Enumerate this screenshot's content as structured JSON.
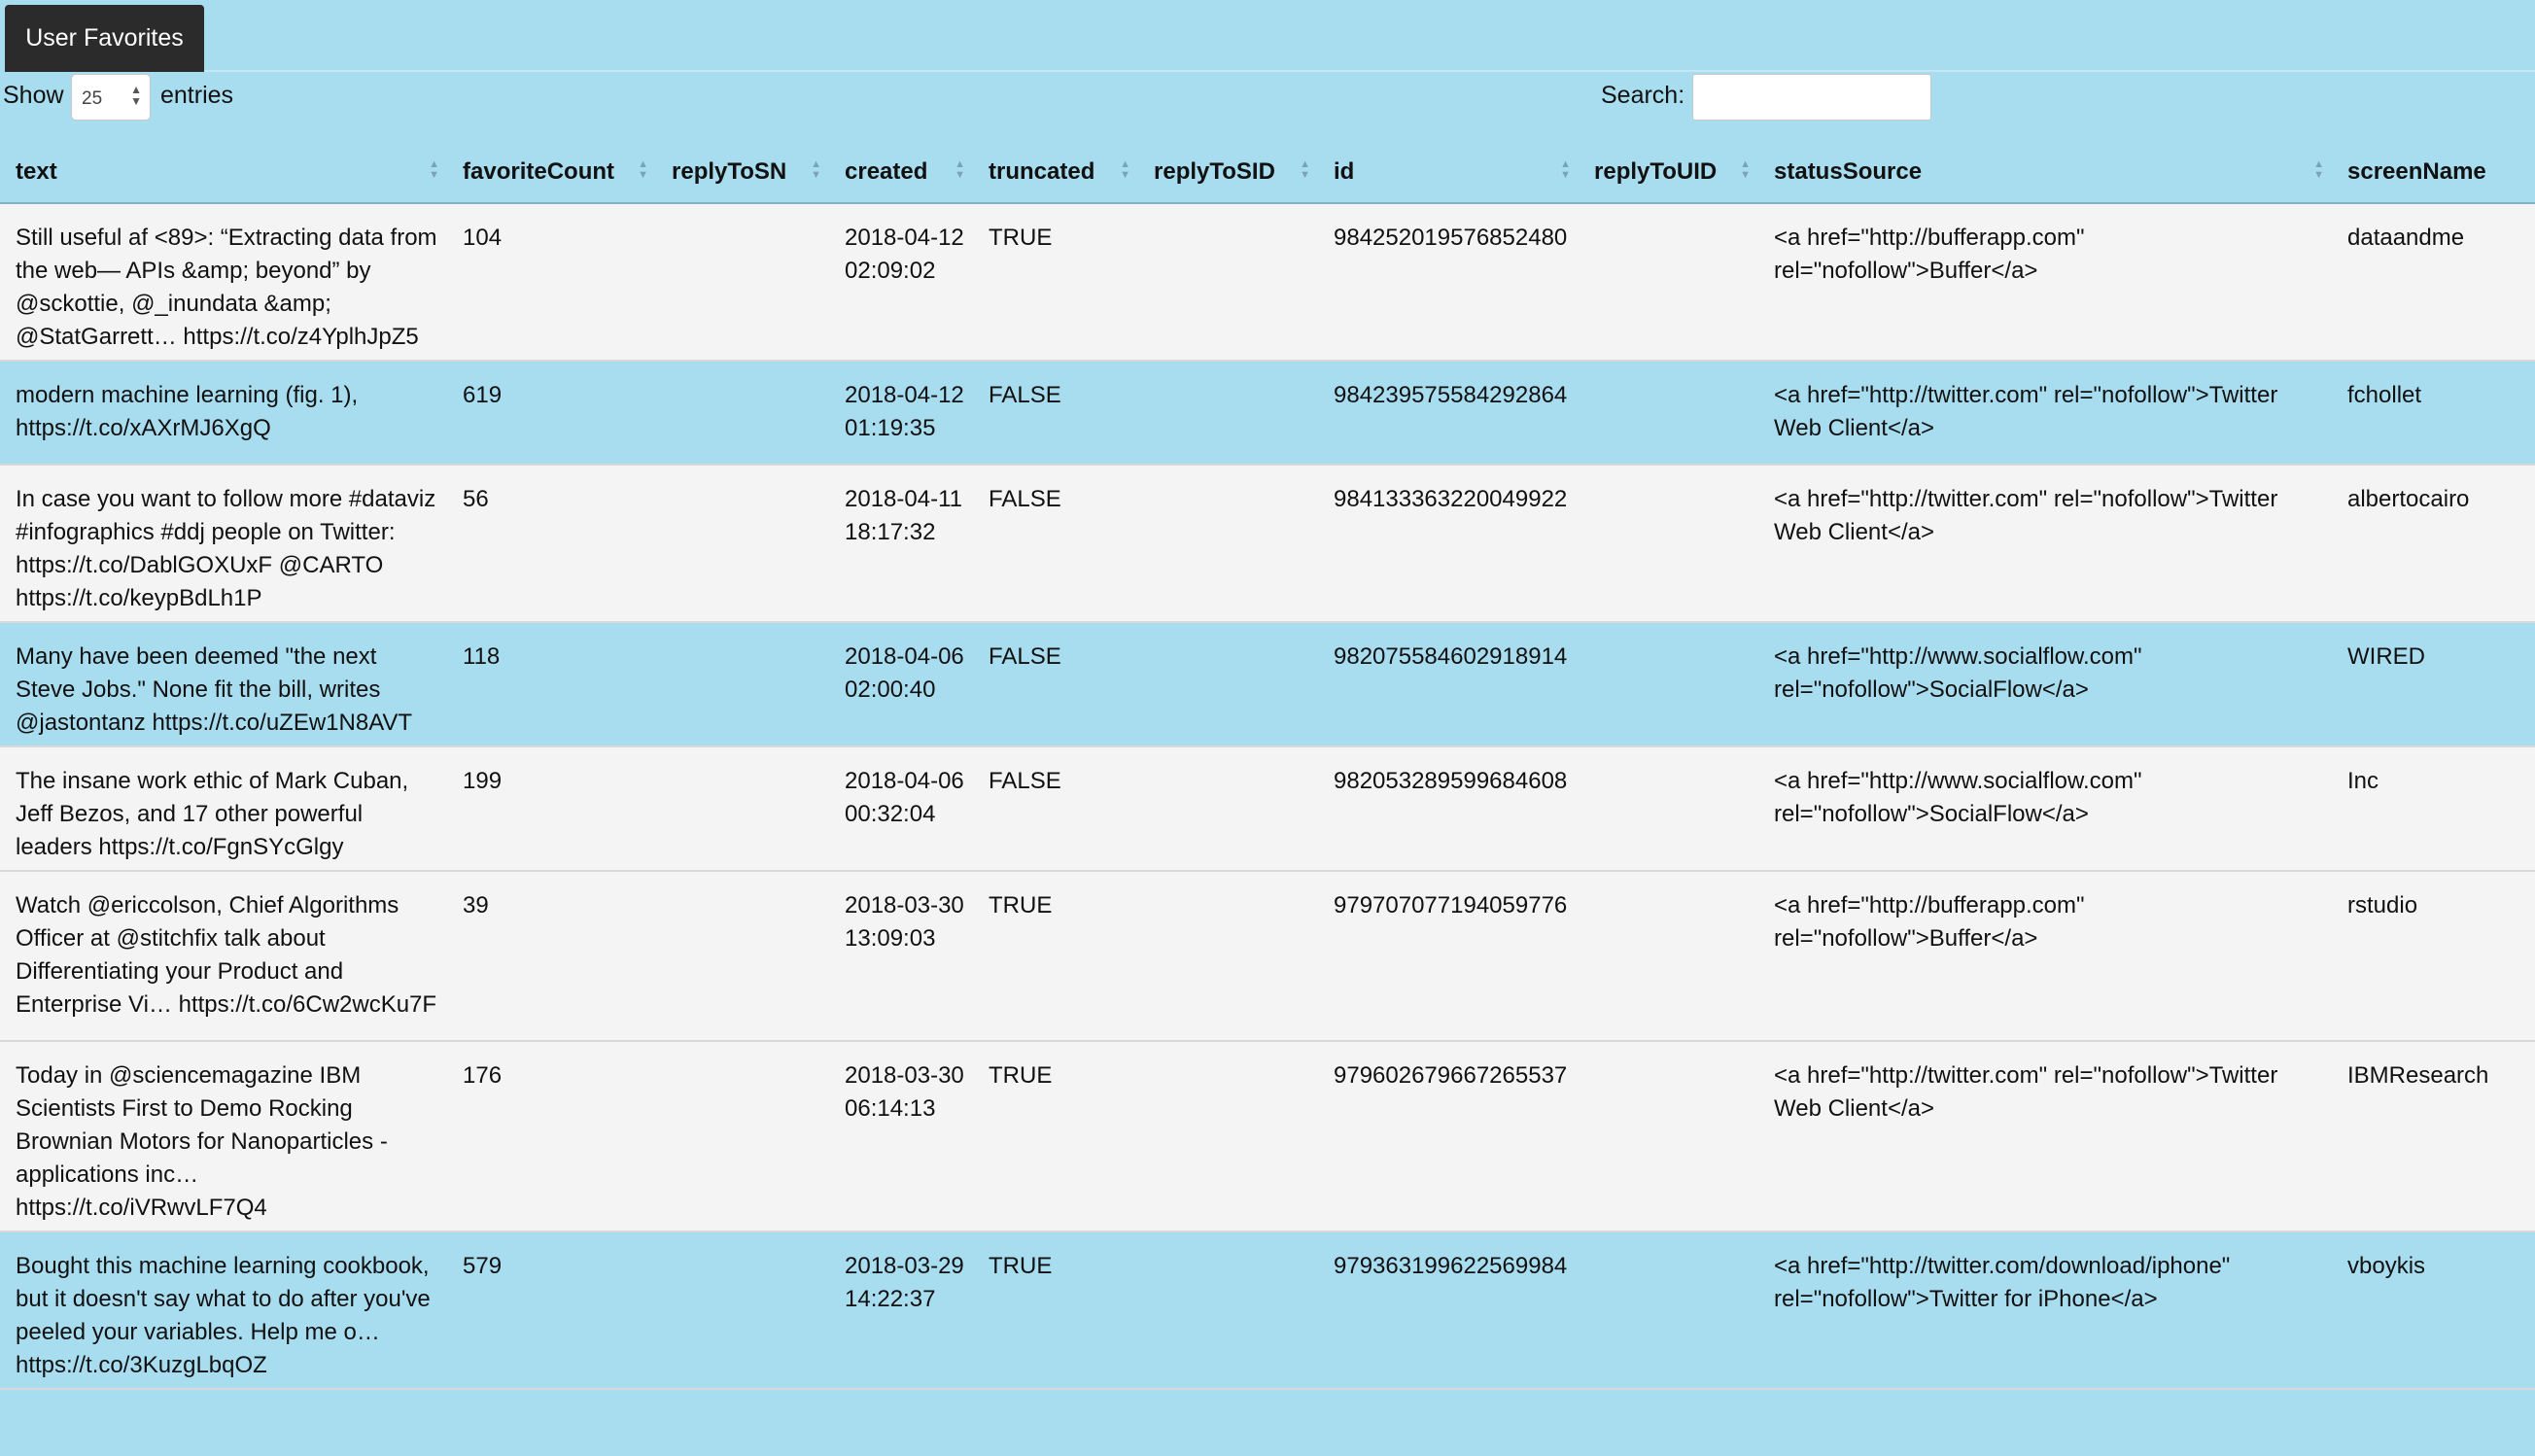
{
  "tab": {
    "label": "User Favorites"
  },
  "controls": {
    "show_label": "Show",
    "page_size": "25",
    "entries_label": "entries",
    "search_label": "Search:",
    "search_value": ""
  },
  "table": {
    "columns": [
      "text",
      "favoriteCount",
      "replyToSN",
      "created",
      "truncated",
      "replyToSID",
      "id",
      "replyToUID",
      "statusSource",
      "screenName"
    ],
    "rows": [
      {
        "text": "Still useful af <89>: “Extracting data from the web— APIs &amp; beyond” by @sckottie, @_inundata &amp; @StatGarrett… https://t.co/z4YplhJpZ5",
        "favoriteCount": "104",
        "replyToSN": "",
        "created": "2018-04-12 02:09:02",
        "truncated": "TRUE",
        "replyToSID": "",
        "id": "984252019576852480",
        "replyToUID": "",
        "statusSource": "<a href=\"http://bufferapp.com\" rel=\"nofollow\">Buffer</a>",
        "screenName": "dataandme"
      },
      {
        "text": "modern machine learning (fig. 1), https://t.co/xAXrMJ6XgQ",
        "favoriteCount": "619",
        "replyToSN": "",
        "created": "2018-04-12 01:19:35",
        "truncated": "FALSE",
        "replyToSID": "",
        "id": "984239575584292864",
        "replyToUID": "",
        "statusSource": "<a href=\"http://twitter.com\" rel=\"nofollow\">Twitter Web Client</a>",
        "screenName": "fchollet"
      },
      {
        "text": "In case you want to follow more #dataviz #infographics #ddj people on Twitter: https://t.co/DablGOXUxF @CARTO https://t.co/keypBdLh1P",
        "favoriteCount": "56",
        "replyToSN": "",
        "created": "2018-04-11 18:17:32",
        "truncated": "FALSE",
        "replyToSID": "",
        "id": "984133363220049922",
        "replyToUID": "",
        "statusSource": "<a href=\"http://twitter.com\" rel=\"nofollow\">Twitter Web Client</a>",
        "screenName": "albertocairo"
      },
      {
        "text": "Many have been deemed \"the next Steve Jobs.\" None fit the bill, writes @jastontanz https://t.co/uZEw1N8AVT",
        "favoriteCount": "118",
        "replyToSN": "",
        "created": "2018-04-06 02:00:40",
        "truncated": "FALSE",
        "replyToSID": "",
        "id": "982075584602918914",
        "replyToUID": "",
        "statusSource": "<a href=\"http://www.socialflow.com\" rel=\"nofollow\">SocialFlow</a>",
        "screenName": "WIRED"
      },
      {
        "text": "The insane work ethic of Mark Cuban, Jeff Bezos, and 17 other powerful leaders https://t.co/FgnSYcGlgy",
        "favoriteCount": "199",
        "replyToSN": "",
        "created": "2018-04-06 00:32:04",
        "truncated": "FALSE",
        "replyToSID": "",
        "id": "982053289599684608",
        "replyToUID": "",
        "statusSource": "<a href=\"http://www.socialflow.com\" rel=\"nofollow\">SocialFlow</a>",
        "screenName": "Inc"
      },
      {
        "text": "Watch @ericcolson, Chief Algorithms Officer at @stitchfix talk about Differentiating your Product and Enterprise Vi… https://t.co/6Cw2wcKu7F",
        "favoriteCount": "39",
        "replyToSN": "",
        "created": "2018-03-30 13:09:03",
        "truncated": "TRUE",
        "replyToSID": "",
        "id": "979707077194059776",
        "replyToUID": "",
        "statusSource": "<a href=\"http://bufferapp.com\" rel=\"nofollow\">Buffer</a>",
        "screenName": "rstudio"
      },
      {
        "text": "Today in @sciencemagazine IBM Scientists First to Demo Rocking Brownian Motors for Nanoparticles - applications inc… https://t.co/iVRwvLF7Q4",
        "favoriteCount": "176",
        "replyToSN": "",
        "created": "2018-03-30 06:14:13",
        "truncated": "TRUE",
        "replyToSID": "",
        "id": "979602679667265537",
        "replyToUID": "",
        "statusSource": "<a href=\"http://twitter.com\" rel=\"nofollow\">Twitter Web Client</a>",
        "screenName": "IBMResearch"
      },
      {
        "text": "Bought this machine learning cookbook, but it doesn't say what to do after you've peeled your variables. Help me o… https://t.co/3KuzgLbqOZ",
        "favoriteCount": "579",
        "replyToSN": "",
        "created": "2018-03-29 14:22:37",
        "truncated": "TRUE",
        "replyToSID": "",
        "id": "979363199622569984",
        "replyToUID": "",
        "statusSource": "<a href=\"http://twitter.com/download/iphone\" rel=\"nofollow\">Twitter for iPhone</a>",
        "screenName": "vboykis"
      }
    ]
  }
}
